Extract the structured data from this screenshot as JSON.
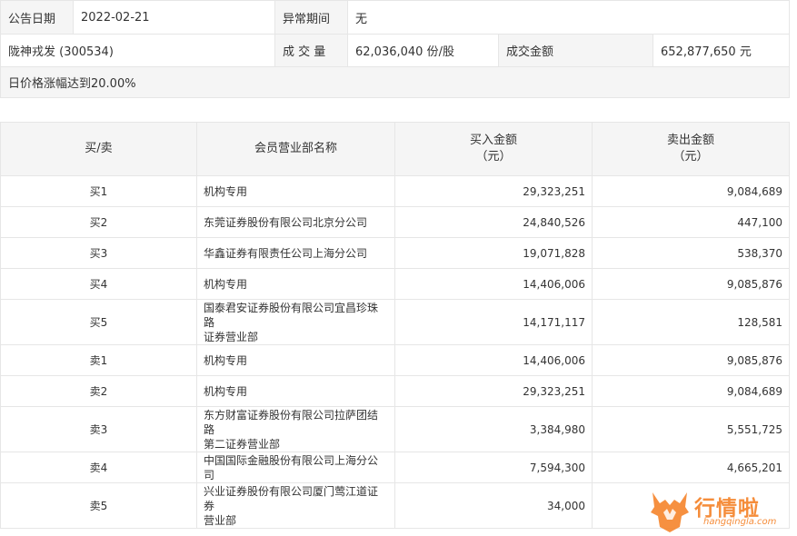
{
  "info": {
    "date_label": "公告日期",
    "date_value": "2022-02-21",
    "period_label": "异常期间",
    "period_value": "无",
    "stock_name": "陇神戎发 (300534)",
    "volume_label": "成 交 量",
    "volume_value": "62,036,040 份/股",
    "amount_label": "成交金额",
    "amount_value": "652,877,650 元",
    "reason": "日价格涨幅达到20.00%"
  },
  "table": {
    "headers": {
      "side": "买/卖",
      "broker": "会员营业部名称",
      "buy_line1": "买入金额",
      "buy_line2": "（元）",
      "sell_line1": "卖出金额",
      "sell_line2": "（元）"
    },
    "rows": [
      {
        "side": "买1",
        "broker_l1": "机构专用",
        "broker_l2": "",
        "buy": "29,323,251",
        "sell": "9,084,689"
      },
      {
        "side": "买2",
        "broker_l1": "东莞证券股份有限公司北京分公司",
        "broker_l2": "",
        "buy": "24,840,526",
        "sell": "447,100"
      },
      {
        "side": "买3",
        "broker_l1": "华鑫证券有限责任公司上海分公司",
        "broker_l2": "",
        "buy": "19,071,828",
        "sell": "538,370"
      },
      {
        "side": "买4",
        "broker_l1": "机构专用",
        "broker_l2": "",
        "buy": "14,406,006",
        "sell": "9,085,876"
      },
      {
        "side": "买5",
        "broker_l1": "国泰君安证券股份有限公司宜昌珍珠路",
        "broker_l2": "证券营业部",
        "buy": "14,171,117",
        "sell": "128,581"
      },
      {
        "side": "卖1",
        "broker_l1": "机构专用",
        "broker_l2": "",
        "buy": "14,406,006",
        "sell": "9,085,876"
      },
      {
        "side": "卖2",
        "broker_l1": "机构专用",
        "broker_l2": "",
        "buy": "29,323,251",
        "sell": "9,084,689"
      },
      {
        "side": "卖3",
        "broker_l1": "东方财富证券股份有限公司拉萨团结路",
        "broker_l2": "第二证券营业部",
        "buy": "3,384,980",
        "sell": "5,551,725"
      },
      {
        "side": "卖4",
        "broker_l1": "中国国际金融股份有限公司上海分公司",
        "broker_l2": "",
        "buy": "7,594,300",
        "sell": "4,665,201"
      },
      {
        "side": "卖5",
        "broker_l1": "兴业证券股份有限公司厦门莺江道证券",
        "broker_l2": "营业部",
        "buy": "34,000",
        "sell": ""
      }
    ]
  },
  "watermark": {
    "text": "行情啦",
    "domain": "hangqingla.com",
    "color": "#f5842b"
  }
}
